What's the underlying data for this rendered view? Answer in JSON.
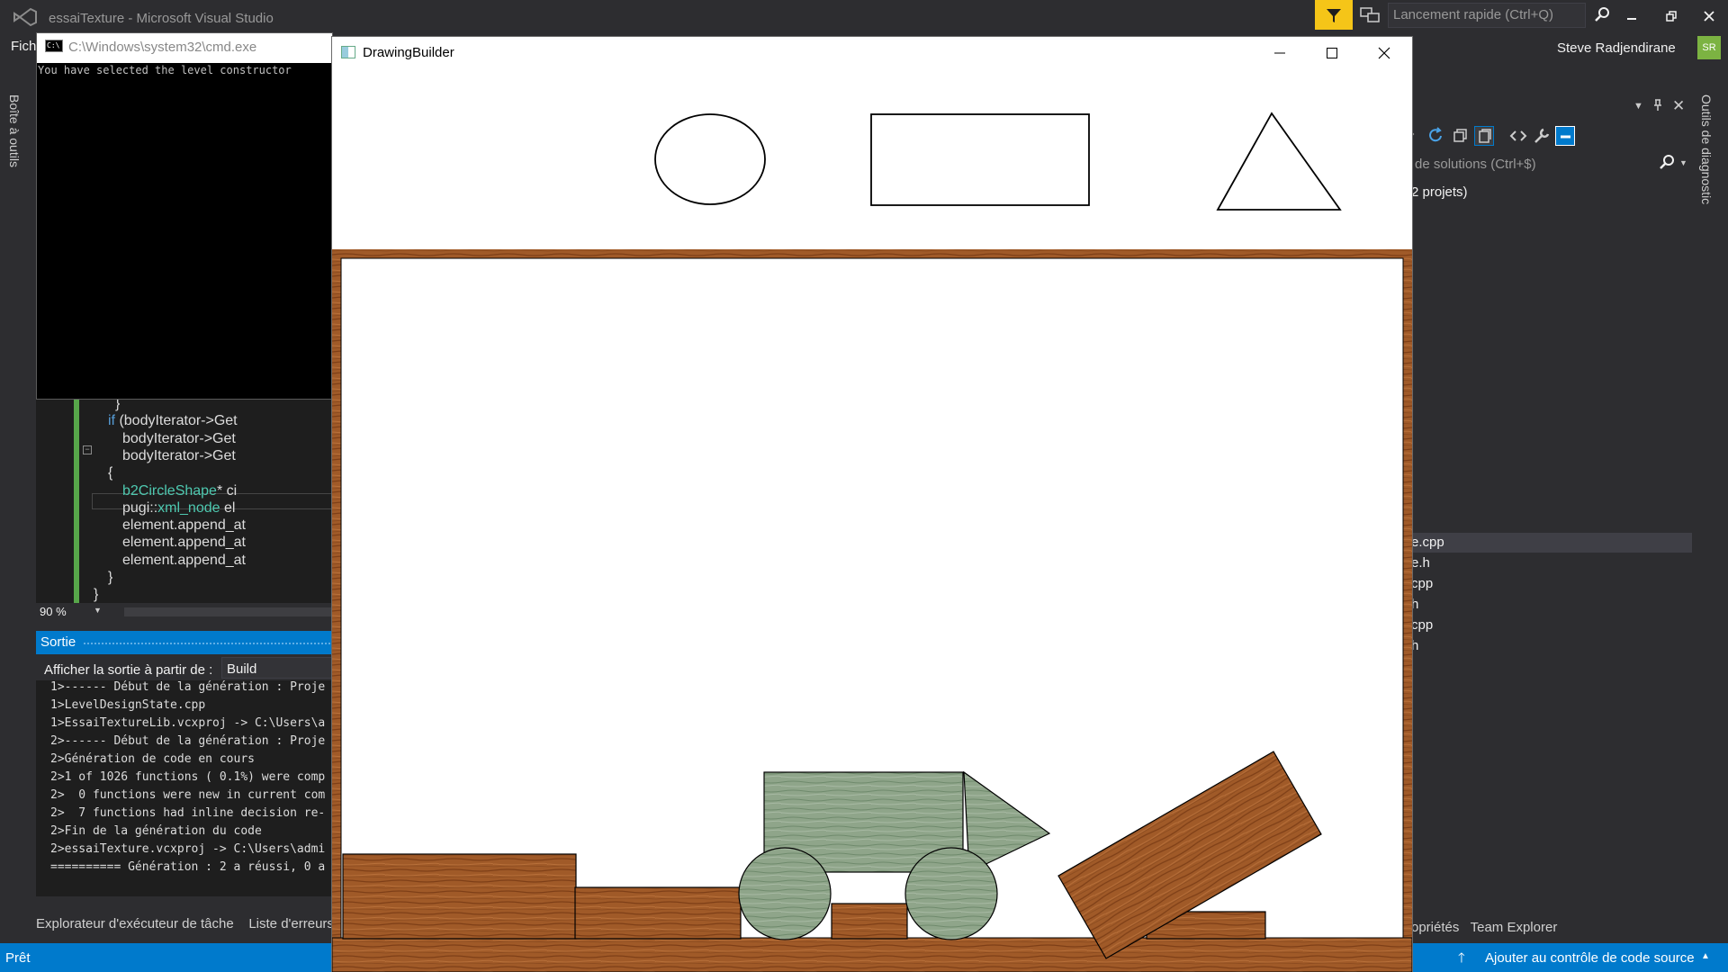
{
  "vs": {
    "window_title": "essaiTexture - Microsoft Visual Studio",
    "quick_launch_placeholder": "Lancement rapide (Ctrl+Q)",
    "user_name": "Steve Radjendirane",
    "user_initials": "SR",
    "menu_partial": "Fichi",
    "toolbox_label": "Boîte à outils",
    "diagnostics_label": "Outils de diagnostic",
    "status_text": "Prêt",
    "source_control_label": "Ajouter au contrôle de code source",
    "colors": {
      "accent": "#007acc",
      "filter": "#f5c518",
      "background": "#2d2d30",
      "editor": "#1e1e1e"
    }
  },
  "editor": {
    "zoom": "90 %",
    "lines": [
      {
        "indent": 11,
        "text": "}"
      },
      {
        "indent": 10,
        "text": "if (bodyIterator->Get"
      },
      {
        "indent": 12,
        "text": "bodyIterator->Get"
      },
      {
        "indent": 12,
        "text": "bodyIterator->Get"
      },
      {
        "indent": 10,
        "text": "{"
      },
      {
        "indent": 12,
        "text": "b2CircleShape* ci"
      },
      {
        "indent": 12,
        "text": "pugi::xml_node el"
      },
      {
        "indent": 12,
        "text": "element.append_at"
      },
      {
        "indent": 12,
        "text": "element.append_at"
      },
      {
        "indent": 12,
        "text": "element.append_at"
      },
      {
        "indent": 10,
        "text": "}"
      },
      {
        "indent": 8,
        "text": "}"
      }
    ]
  },
  "output": {
    "title": "Sortie",
    "source_label": "Afficher la sortie à partir de :",
    "source_value": "Build",
    "lines": [
      "1>------ Début de la génération : Proje",
      "1>LevelDesignState.cpp",
      "1>EssaiTextureLib.vcxproj -> C:\\Users\\a",
      "2>------ Début de la génération : Proje",
      "2>Génération de code en cours",
      "2>1 of 1026 functions ( 0.1%) were comp",
      "2>  0 functions were new in current com",
      "2>  7 functions had inline decision re-",
      "2>Fin de la génération du code",
      "2>essaiTexture.vcxproj -> C:\\Users\\admi",
      "========== Génération : 2 a réussi, 0 a"
    ],
    "bottom_tabs": [
      "Explorateur d'exécuteur de tâche",
      "Liste d'erreurs"
    ]
  },
  "solution_explorer": {
    "search_placeholder": "de solutions (Ctrl+$)",
    "projects_label": "2 projets)",
    "files": [
      "e.cpp",
      "e.h",
      "cpp",
      "h",
      "cpp",
      "h"
    ],
    "bottom_tabs": [
      "opriétés",
      "Team Explorer"
    ],
    "icons": [
      "sync-icon",
      "refresh-icon",
      "collapse-all-icon",
      "show-all-files-icon",
      "view-code-icon",
      "properties-wrench-icon",
      "preview-icon"
    ]
  },
  "cmd": {
    "title": "C:\\Windows\\system32\\cmd.exe",
    "output": "You have selected the level constructor"
  },
  "drawing_builder": {
    "title": "DrawingBuilder",
    "palette": [
      "circle",
      "rectangle",
      "triangle"
    ],
    "colors": {
      "wood": "#9c5322",
      "stone": "#8fa58a",
      "frame": "#a8602a"
    }
  }
}
